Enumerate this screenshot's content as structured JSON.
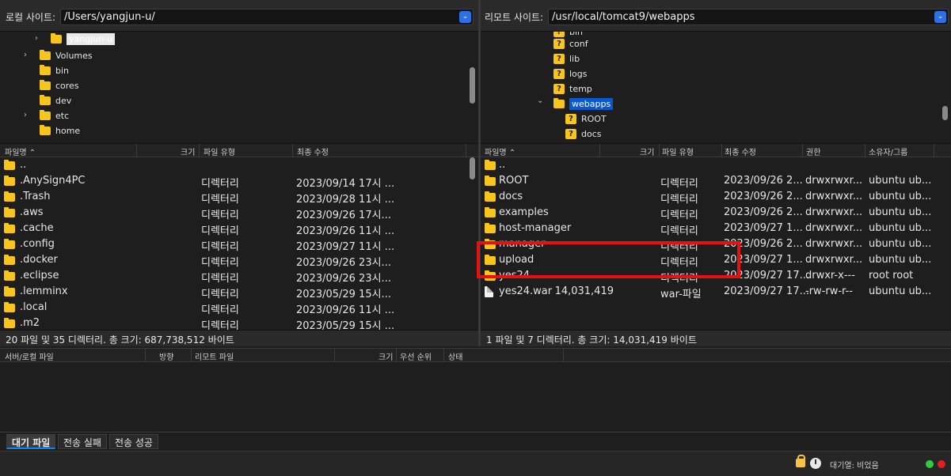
{
  "left": {
    "site_label": "로컬 사이트:",
    "path": "/Users/yangjun-u/",
    "tree": [
      {
        "label": "yangjun-u",
        "state": "highlighted",
        "chevron": "›",
        "qicon": false
      },
      {
        "label": "Volumes",
        "chevron": "›",
        "qicon": false
      },
      {
        "label": "bin",
        "chevron": "",
        "qicon": false
      },
      {
        "label": "cores",
        "chevron": "",
        "qicon": false
      },
      {
        "label": "dev",
        "chevron": "",
        "qicon": false
      },
      {
        "label": "etc",
        "chevron": "›",
        "qicon": false
      },
      {
        "label": "home",
        "chevron": "",
        "qicon": false
      }
    ],
    "columns": [
      "파일명",
      "크기",
      "파일 유형",
      "최종 수정"
    ],
    "files": [
      {
        "name": "..",
        "size": "",
        "type": "",
        "modified": "",
        "icon": "folder"
      },
      {
        "name": ".AnySign4PC",
        "size": "",
        "type": "디렉터리",
        "modified": "2023/09/14 17시 ...",
        "icon": "folder"
      },
      {
        "name": ".Trash",
        "size": "",
        "type": "디렉터리",
        "modified": "2023/09/28 11시 ...",
        "icon": "folder"
      },
      {
        "name": ".aws",
        "size": "",
        "type": "디렉터리",
        "modified": "2023/09/26 17시...",
        "icon": "folder"
      },
      {
        "name": ".cache",
        "size": "",
        "type": "디렉터리",
        "modified": "2023/09/26 11시 ...",
        "icon": "folder"
      },
      {
        "name": ".config",
        "size": "",
        "type": "디렉터리",
        "modified": "2023/09/27 11시 ...",
        "icon": "folder"
      },
      {
        "name": ".docker",
        "size": "",
        "type": "디렉터리",
        "modified": "2023/09/26 23시...",
        "icon": "folder"
      },
      {
        "name": ".eclipse",
        "size": "",
        "type": "디렉터리",
        "modified": "2023/09/26 23시...",
        "icon": "folder"
      },
      {
        "name": ".lemminx",
        "size": "",
        "type": "디렉터리",
        "modified": "2023/05/29 15시...",
        "icon": "folder"
      },
      {
        "name": ".local",
        "size": "",
        "type": "디렉터리",
        "modified": "2023/09/26 11시 ...",
        "icon": "folder"
      },
      {
        "name": ".m2",
        "size": "",
        "type": "디렉터리",
        "modified": "2023/05/29 15시 ...",
        "icon": "folder"
      }
    ],
    "status": "20 파일 및 35 디렉터리. 총 크기: 687,738,512 바이트"
  },
  "right": {
    "site_label": "리모트 사이트:",
    "path": "/usr/local/tomcat9/webapps",
    "tree": [
      {
        "label": "bin",
        "chevron": "",
        "qicon": true
      },
      {
        "label": "conf",
        "chevron": "",
        "qicon": true
      },
      {
        "label": "lib",
        "chevron": "",
        "qicon": true
      },
      {
        "label": "logs",
        "chevron": "",
        "qicon": true
      },
      {
        "label": "temp",
        "chevron": "",
        "qicon": true
      },
      {
        "label": "webapps",
        "chevron": "⌄",
        "qicon": false,
        "state": "selected"
      },
      {
        "label": "ROOT",
        "chevron": "",
        "qicon": true
      },
      {
        "label": "docs",
        "chevron": "",
        "qicon": true
      }
    ],
    "columns": [
      "파일명",
      "크기",
      "파일 유형",
      "최종 수정",
      "권한",
      "소유자/그룹"
    ],
    "files": [
      {
        "name": "..",
        "size": "",
        "type": "",
        "modified": "",
        "perm": "",
        "owner": "",
        "icon": "folder"
      },
      {
        "name": "ROOT",
        "size": "",
        "type": "디렉터리",
        "modified": "2023/09/26 2...",
        "perm": "drwxrwxr...",
        "owner": "ubuntu ub...",
        "icon": "folder"
      },
      {
        "name": "docs",
        "size": "",
        "type": "디렉터리",
        "modified": "2023/09/26 2...",
        "perm": "drwxrwxr...",
        "owner": "ubuntu ub...",
        "icon": "folder"
      },
      {
        "name": "examples",
        "size": "",
        "type": "디렉터리",
        "modified": "2023/09/26 2...",
        "perm": "drwxrwxr...",
        "owner": "ubuntu ub...",
        "icon": "folder"
      },
      {
        "name": "host-manager",
        "size": "",
        "type": "디렉터리",
        "modified": "2023/09/27 1...",
        "perm": "drwxrwxr...",
        "owner": "ubuntu ub...",
        "icon": "folder"
      },
      {
        "name": "manager",
        "size": "",
        "type": "디렉터리",
        "modified": "2023/09/26 2...",
        "perm": "drwxrwxr...",
        "owner": "ubuntu ub...",
        "icon": "folder"
      },
      {
        "name": "upload",
        "size": "",
        "type": "디렉터리",
        "modified": "2023/09/27 1...",
        "perm": "drwxrwxr...",
        "owner": "ubuntu ub...",
        "icon": "folder"
      },
      {
        "name": "yes24",
        "size": "",
        "type": "디렉터리",
        "modified": "2023/09/27 17...",
        "perm": "drwxr-x---",
        "owner": "root root",
        "icon": "folder"
      },
      {
        "name": "yes24.war",
        "size": "14,031,419",
        "type": "war-파일",
        "modified": "2023/09/27 17...",
        "perm": "-rw-rw-r--",
        "owner": "ubuntu ub...",
        "icon": "file"
      }
    ],
    "status": "1 파일 및 7 디렉터리. 총 크기: 14,031,419 바이트"
  },
  "queue": {
    "columns": [
      "서버/로컬 파일",
      "방향",
      "리모트 파일",
      "크기",
      "우선 순위",
      "상태"
    ]
  },
  "tabs": [
    "대기 파일",
    "전송 실패",
    "전송 성공"
  ],
  "bottom": {
    "queue_status": "대기열: 비었음",
    "led_colors": [
      "#2ecc40",
      "#e02020"
    ]
  },
  "colors": {
    "folder": "#f8c51c",
    "selection": "#0b57d0",
    "annotation_box": "#e61212"
  }
}
